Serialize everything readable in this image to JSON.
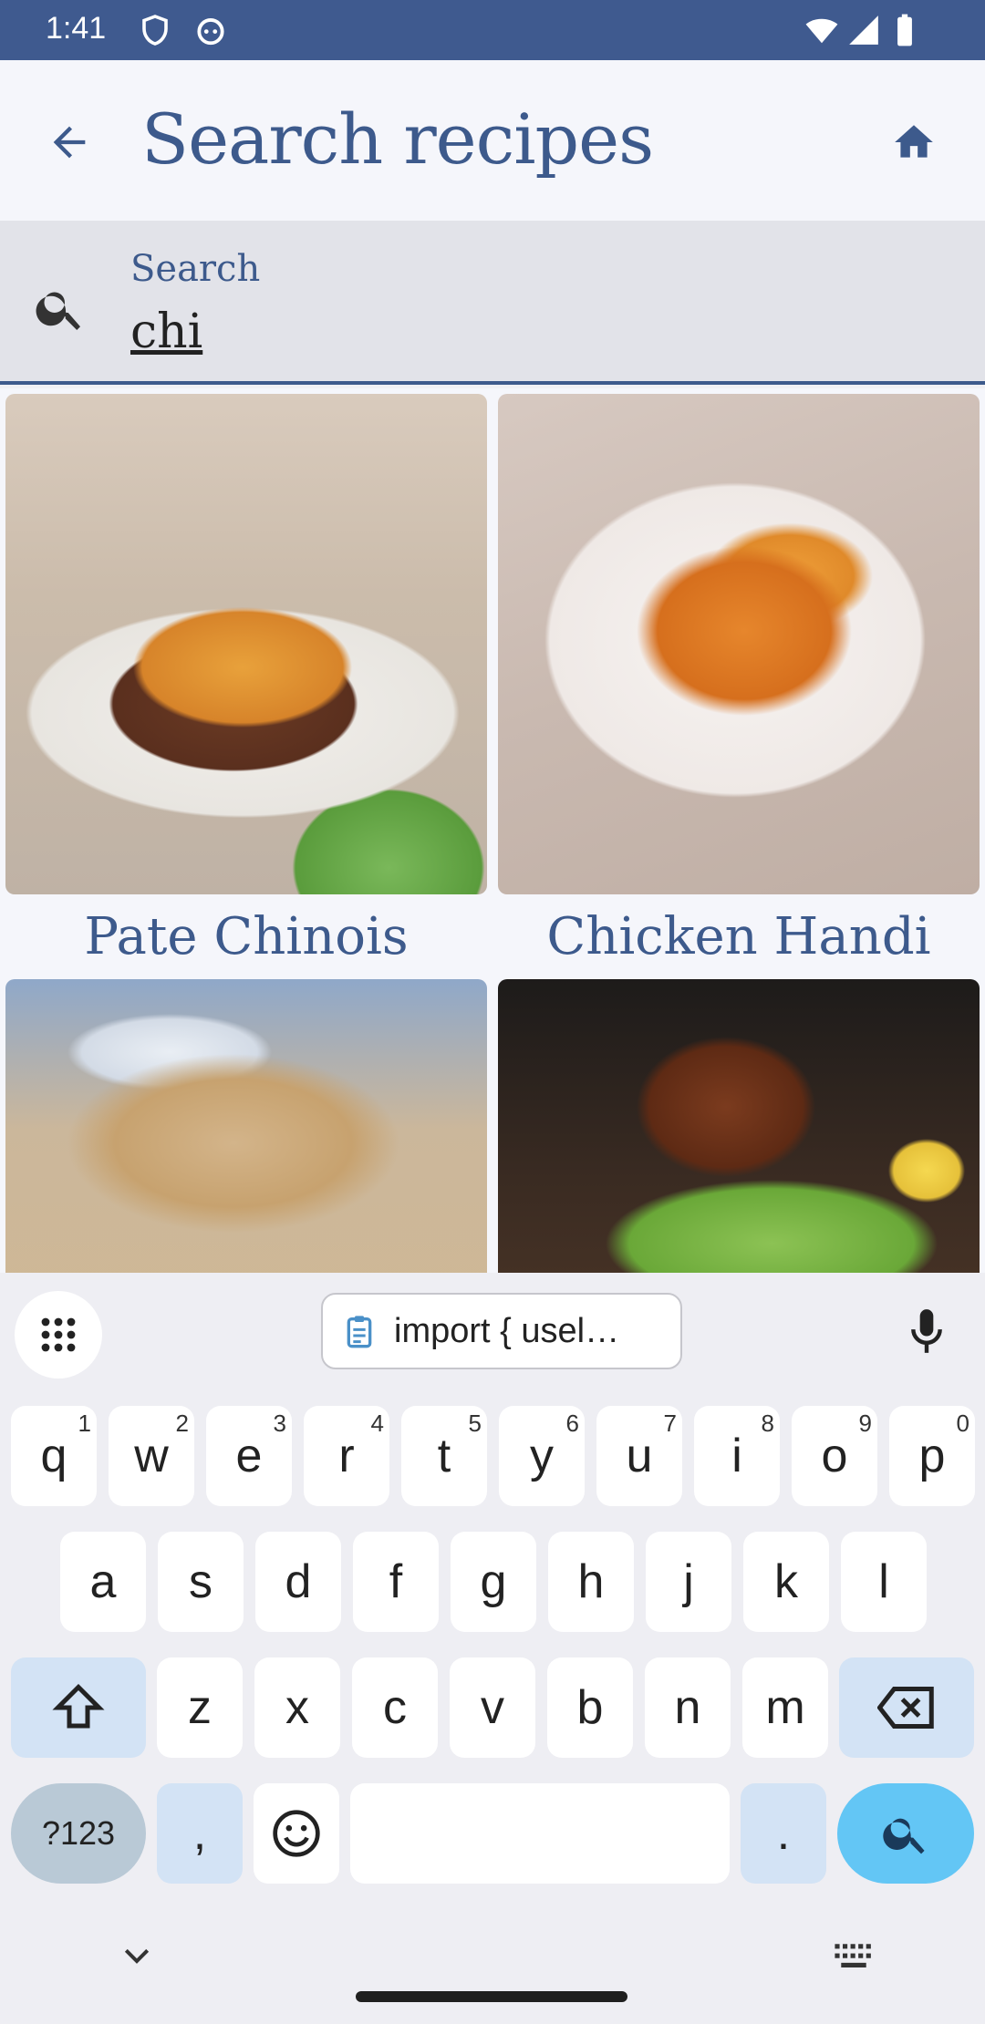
{
  "status_bar": {
    "time": "1:41"
  },
  "app_bar": {
    "title": "Search recipes"
  },
  "search": {
    "label": "Search",
    "value": "chi"
  },
  "recipes": [
    {
      "title": "Pate Chinois"
    },
    {
      "title": "Chicken Handi"
    },
    {
      "title": ""
    },
    {
      "title": ""
    }
  ],
  "keyboard": {
    "clipboard_text": "import { usel…",
    "row1": [
      {
        "key": "q",
        "hint": "1"
      },
      {
        "key": "w",
        "hint": "2"
      },
      {
        "key": "e",
        "hint": "3"
      },
      {
        "key": "r",
        "hint": "4"
      },
      {
        "key": "t",
        "hint": "5"
      },
      {
        "key": "y",
        "hint": "6"
      },
      {
        "key": "u",
        "hint": "7"
      },
      {
        "key": "i",
        "hint": "8"
      },
      {
        "key": "o",
        "hint": "9"
      },
      {
        "key": "p",
        "hint": "0"
      }
    ],
    "row2": [
      "a",
      "s",
      "d",
      "f",
      "g",
      "h",
      "j",
      "k",
      "l"
    ],
    "row3": [
      "z",
      "x",
      "c",
      "v",
      "b",
      "n",
      "m"
    ],
    "symbols_label": "?123",
    "comma": ",",
    "period": "."
  },
  "colors": {
    "accent": "#3d5a8c",
    "status_bar": "#3f5a8f",
    "search_key": "#63c6f5"
  }
}
